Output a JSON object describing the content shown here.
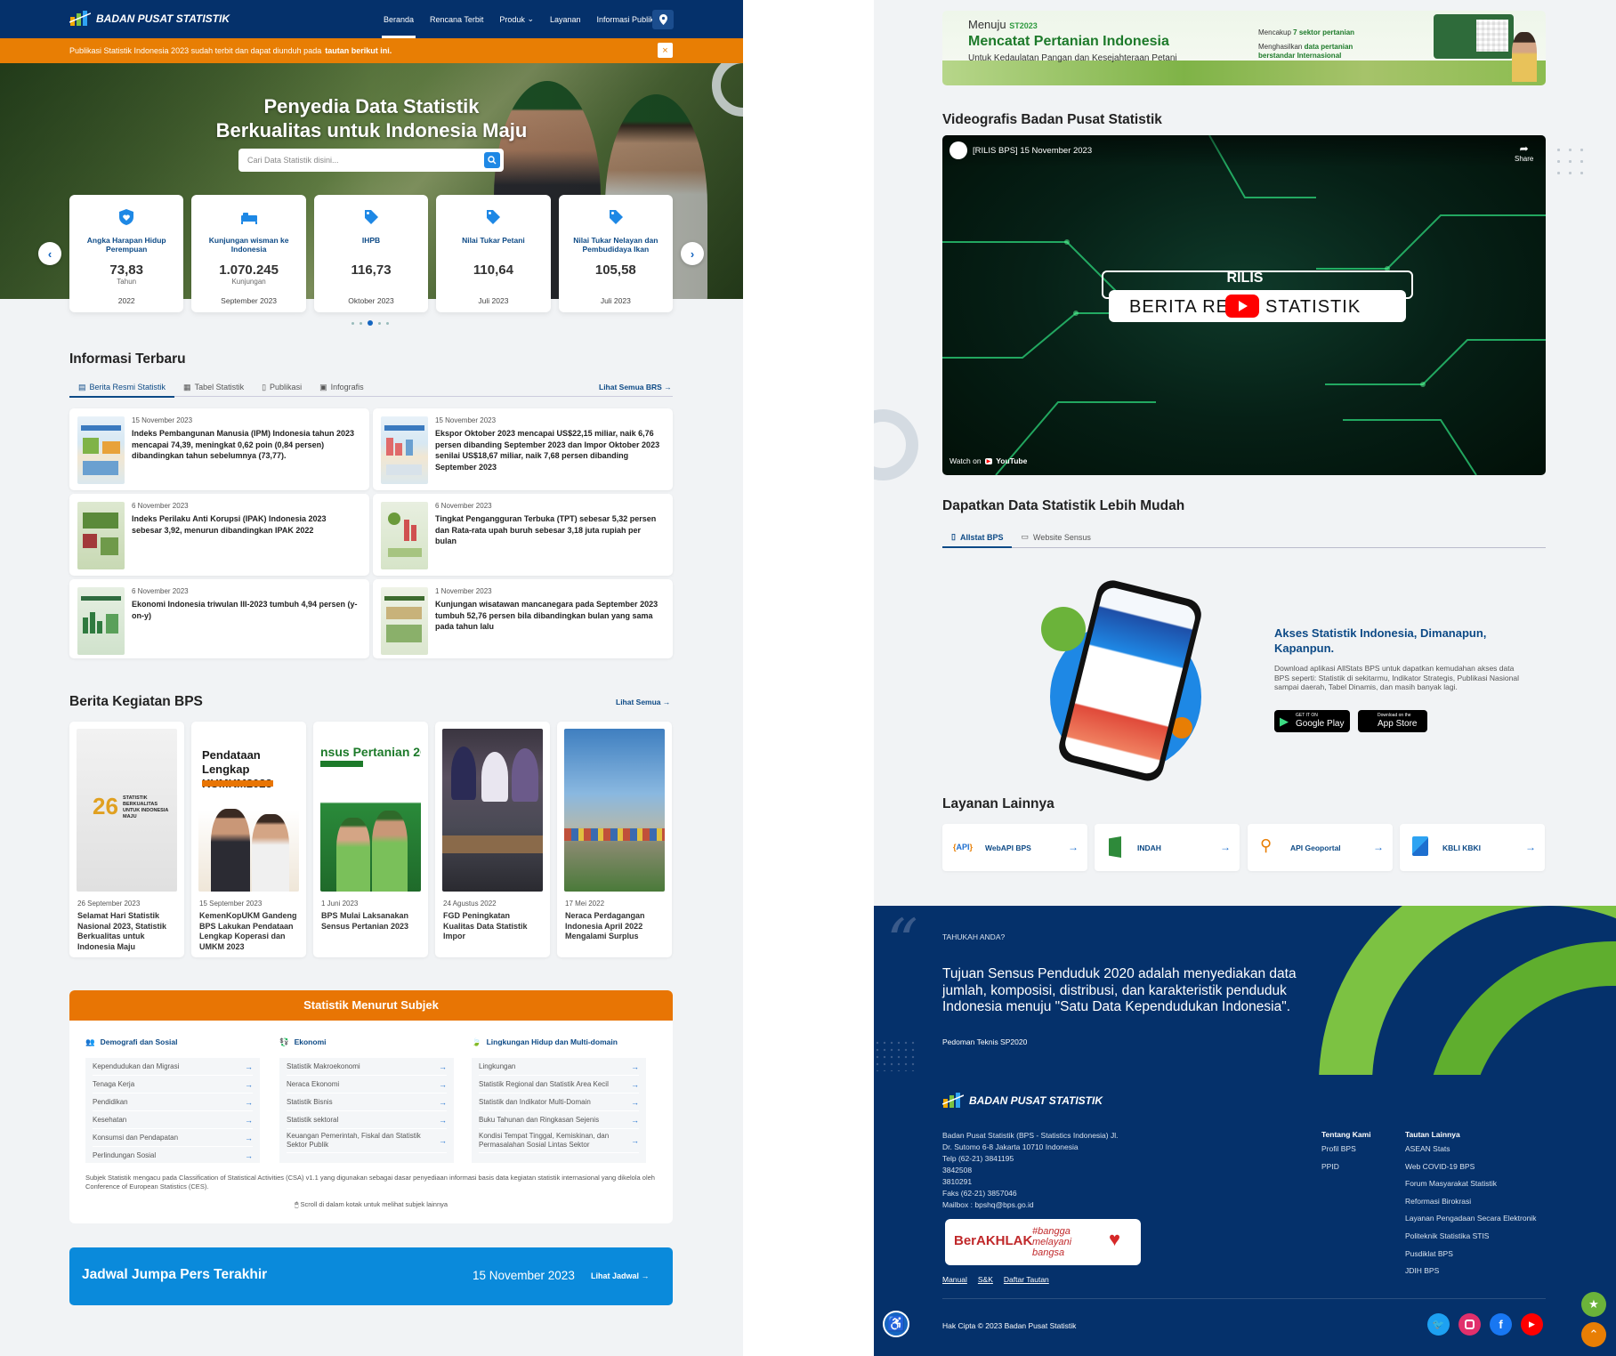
{
  "nav": {
    "brand": "BADAN PUSAT STATISTIK",
    "items": [
      "Beranda",
      "Rencana Terbit",
      "Produk",
      "Layanan",
      "Informasi Publik"
    ]
  },
  "banner": {
    "text": "Publikasi Statistik Indonesia 2023 sudah terbit dan dapat diunduh pada",
    "link": "tautan berikut ini.",
    "close": "×"
  },
  "hero": {
    "title_line1": "Penyedia Data Statistik",
    "title_line2": "Berkualitas untuk Indonesia Maju",
    "search_placeholder": "Cari Data Statistik disini..."
  },
  "indicators": [
    {
      "title": "Angka Harapan Hidup Perempuan",
      "value": "73,83",
      "unit": "Tahun",
      "date": "2022",
      "icon": "shield-heart-icon"
    },
    {
      "title": "Kunjungan wisman ke Indonesia",
      "value": "1.070.245",
      "unit": "Kunjungan",
      "date": "September 2023",
      "icon": "bed-icon"
    },
    {
      "title": "IHPB",
      "value": "116,73",
      "unit": "",
      "date": "Oktober 2023",
      "icon": "price-tag-icon"
    },
    {
      "title": "Nilai Tukar Petani",
      "value": "110,64",
      "unit": "",
      "date": "Juli 2023",
      "icon": "price-tag-icon"
    },
    {
      "title": "Nilai Tukar Nelayan dan Pembudidaya Ikan",
      "value": "105,58",
      "unit": "",
      "date": "Juli 2023",
      "icon": "price-tag-icon"
    }
  ],
  "info": {
    "heading": "Informasi Terbaru",
    "tabs": [
      "Berita Resmi Statistik",
      "Tabel Statistik",
      "Publikasi",
      "Infografis"
    ],
    "see_all": "Lihat Semua BRS →",
    "news": [
      {
        "date": "15 November 2023",
        "title": "Indeks Pembangunan Manusia (IPM) Indonesia tahun 2023 mencapai 74,39, meningkat 0,62 poin (0,84 persen) dibandingkan tahun sebelumnya (73,77)."
      },
      {
        "date": "15 November 2023",
        "title": "Ekspor Oktober 2023 mencapai US$22,15 miliar, naik 6,76 persen dibanding September 2023 dan Impor Oktober 2023 senilai US$18,67 miliar, naik 7,68 persen dibanding September 2023"
      },
      {
        "date": "6 November 2023",
        "title": "Indeks Perilaku Anti Korupsi (IPAK) Indonesia 2023 sebesar 3,92, menurun dibandingkan IPAK 2022"
      },
      {
        "date": "6 November 2023",
        "title": "Tingkat Pengangguran Terbuka (TPT) sebesar 5,32 persen dan Rata-rata upah buruh sebesar 3,18 juta rupiah per bulan"
      },
      {
        "date": "6 November 2023",
        "title": "Ekonomi Indonesia triwulan III-2023 tumbuh 4,94 persen (y-on-y)"
      },
      {
        "date": "1 November 2023",
        "title": "Kunjungan wisatawan mancanegara pada September 2023 tumbuh 52,76 persen bila dibandingkan bulan yang sama pada tahun lalu"
      }
    ]
  },
  "kegiatan": {
    "heading": "Berita Kegiatan BPS",
    "see_all": "Lihat Semua →",
    "items": [
      {
        "date": "26 September 2023",
        "title": "Selamat Hari Statistik Nasional 2023, Statistik Berkualitas untuk Indonesia Maju",
        "img_text": "STATISTIK BERKUALITAS UNTUK INDONESIA MAJU"
      },
      {
        "date": "15 September 2023",
        "title": "KemenKopUKM Gandeng BPS Lakukan Pendataan Lengkap Koperasi dan UMKM 2023",
        "img_text": "Pendataan Lengkap KUMKM2023"
      },
      {
        "date": "1 Juni 2023",
        "title": "BPS Mulai Laksanakan Sensus Pertanian 2023",
        "img_text": "nsus Pertanian 2C"
      },
      {
        "date": "24 Agustus 2022",
        "title": "FGD Peningkatan Kualitas Data Statistik Impor",
        "img_text": ""
      },
      {
        "date": "17 Mei 2022",
        "title": "Neraca Perdagangan Indonesia April 2022 Mengalami Surplus",
        "img_text": ""
      }
    ]
  },
  "subjek": {
    "heading": "Statistik Menurut Subjek",
    "columns": [
      {
        "title": "Demografi dan Sosial",
        "items": [
          "Kependudukan dan Migrasi",
          "Tenaga Kerja",
          "Pendidikan",
          "Kesehatan",
          "Konsumsi dan Pendapatan",
          "Perlindungan Sosial"
        ]
      },
      {
        "title": "Ekonomi",
        "items": [
          "Statistik Makroekonomi",
          "Neraca Ekonomi",
          "Statistik Bisnis",
          "Statistik sektoral",
          "Keuangan Pemerintah, Fiskal dan Statistik Sektor Publik"
        ]
      },
      {
        "title": "Lingkungan Hidup dan Multi-domain",
        "items": [
          "Lingkungan",
          "Statistik Regional dan Statistik Area Kecil",
          "Statistik dan Indikator Multi-Domain",
          "Buku Tahunan dan Ringkasan Sejenis",
          "Kondisi Tempat Tinggal, Kemiskinan, dan Permasalahan Sosial Lintas Sektor"
        ]
      }
    ],
    "note": "Subjek Statistik mengacu pada Classification of Statistical Activities (CSA) v1.1 yang digunakan sebagai dasar penyediaan informasi basis data kegiatan statistik internasional yang dikelola oleh Conference of European Statistics (CES).",
    "scroll_hint": "Scroll di dalam kotak untuk melihat subjek lainnya"
  },
  "jadwal": {
    "title": "Jadwal Jumpa Pers Terakhir",
    "date": "15 November 2023",
    "link": "Lihat Jadwal →"
  },
  "ad": {
    "menuju": "Menuju",
    "st": "ST2023",
    "title": "Mencatat Pertanian Indonesia",
    "subtitle": "Untuk Kedaulatan Pangan dan Kesejahteraan Petani",
    "point1_pre": "Mencakup",
    "point1_b": "7 sektor pertanian",
    "point2_pre": "Menghasilkan",
    "point2_b": "data pertanian berstandar Internasional"
  },
  "video": {
    "heading": "Videografis Badan Pusat Statistik",
    "title": "[RILIS BPS] 15 November 2023",
    "share": "Share",
    "rilis": "RILIS",
    "berita_a": "BERITA RE",
    "berita_b": "STATISTIK",
    "watch": "Watch on",
    "yt": "YouTube"
  },
  "mudah": {
    "heading": "Dapatkan Data Statistik Lebih Mudah",
    "tabs": [
      "Allstat BPS",
      "Website Sensus"
    ],
    "title": "Akses Statistik Indonesia, Dimanapun, Kapanpun.",
    "desc": "Download aplikasi AllStats BPS untuk dapatkan kemudahan akses data BPS seperti: Statistik di sekitarmu, Indikator Strategis, Publikasi Nasional sampai daerah, Tabel Dinamis, dan masih banyak lagi.",
    "gp_small": "GET IT ON",
    "gp": "Google Play",
    "as_small": "Download on the",
    "as": "App Store"
  },
  "layanan": {
    "heading": "Layanan Lainnya",
    "items": [
      "WebAPI BPS",
      "INDAH",
      "API Geoportal",
      "KBLI KBKI"
    ]
  },
  "tahukah": {
    "label": "TAHUKAH ANDA?",
    "text": "Tujuan Sensus Penduduk 2020 adalah menyediakan data jumlah, komposisi, distribusi, dan karakteristik penduduk Indonesia menuju \"Satu Data Kependudukan Indonesia\".",
    "source": "Pedoman Teknis SP2020"
  },
  "footer": {
    "brand": "BADAN PUSAT STATISTIK",
    "address": [
      "Badan Pusat Statistik (BPS - Statistics Indonesia) Jl.",
      "Dr. Sutomo 6-8 Jakarta 10710 Indonesia",
      "Telp (62-21) 3841195",
      "3842508",
      "3810291",
      "Faks (62-21) 3857046",
      "Mailbox : bpshq@bps.go.id"
    ],
    "tentang_heading": "Tentang Kami",
    "tentang": [
      "Profil BPS",
      "PPID"
    ],
    "tautan_heading": "Tautan Lainnya",
    "tautan": [
      "ASEAN Stats",
      "Web COVID-19 BPS",
      "Forum Masyarakat Statistik",
      "Reformasi Birokrasi",
      "Layanan Pengadaan Secara Elektronik",
      "Politeknik Statistika STIS",
      "Pusdiklat BPS",
      "JDIH BPS"
    ],
    "berakhlak": "BerAKHLAK",
    "bangga": "#bangga melayani bangsa",
    "links": [
      "Manual",
      "S&K",
      "Daftar Tautan"
    ],
    "copyright": "Hak Cipta © 2023 Badan Pusat Statistik"
  }
}
